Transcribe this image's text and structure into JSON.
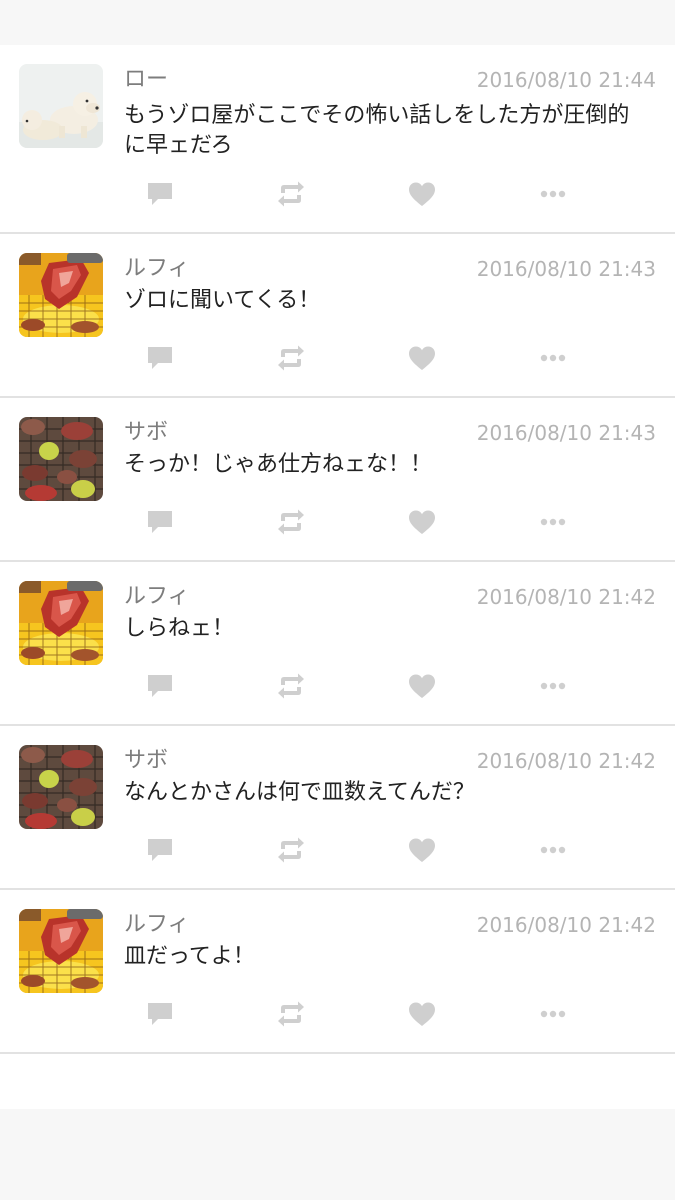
{
  "colors": {
    "page_bg": "#f7f7f7",
    "card_bg": "#ffffff",
    "icon": "#cfcfcf",
    "divider": "#e2e2e2",
    "name": "#7d7d7d",
    "time": "#b4b4b4",
    "text": "#222222"
  },
  "action_icons": [
    "reply-icon",
    "retweet-icon",
    "like-icon",
    "more-icon"
  ],
  "posts": [
    {
      "name": "ロー",
      "time": "2016/08/10 21:44",
      "text": "もうゾロ屋がここでその怖い話しをした方が圧倒的に早ェだろ",
      "avatar": "polar-bear-avatar"
    },
    {
      "name": "ルフィ",
      "time": "2016/08/10 21:43",
      "text": "ゾロに聞いてくる！",
      "avatar": "grilled-meat-avatar"
    },
    {
      "name": "サボ",
      "time": "2016/08/10 21:43",
      "text": "そっか！じゃあ仕方ねェな！！",
      "avatar": "bbq-grill-avatar"
    },
    {
      "name": "ルフィ",
      "time": "2016/08/10 21:42",
      "text": "しらねェ！",
      "avatar": "grilled-meat-avatar"
    },
    {
      "name": "サボ",
      "time": "2016/08/10 21:42",
      "text": "なんとかさんは何で皿数えてんだ？",
      "avatar": "bbq-grill-avatar"
    },
    {
      "name": "ルフィ",
      "time": "2016/08/10 21:42",
      "text": "皿だってよ！",
      "avatar": "grilled-meat-avatar"
    }
  ]
}
